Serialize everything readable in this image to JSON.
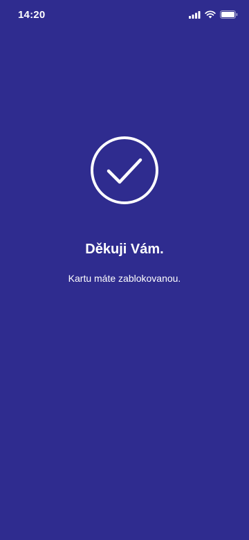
{
  "status_bar": {
    "time": "14:20",
    "icons": [
      "cellular-signal-icon",
      "wifi-icon",
      "battery-icon"
    ]
  },
  "confirmation": {
    "icon": "checkmark-circle-icon",
    "title": "Děkuji Vám.",
    "message": "Kartu máte zablokovanou."
  },
  "colors": {
    "background": "#2f2c8f",
    "foreground": "#ffffff"
  }
}
